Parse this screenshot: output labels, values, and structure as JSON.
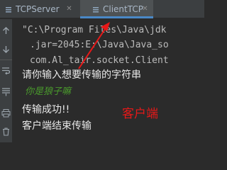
{
  "tabs": [
    {
      "label": "TCPServer",
      "icon": "java-class-icon",
      "close_icon": "close-icon"
    },
    {
      "label": "ClientTCP",
      "icon": "java-class-icon",
      "close_icon": "close-icon",
      "active": true
    }
  ],
  "console": {
    "lines": [
      "\"C:\\Program Files\\Java\\jdk",
      ".jar=2045:E:\\Java\\Java_so",
      "com.Al_tair.socket.Client",
      "请你输入想要传输的字符串",
      "你是狼子嘛",
      "传输成功!!",
      "客户端结束传输"
    ]
  },
  "annotation": {
    "label": "客户端",
    "color": "#e81818"
  },
  "colors": {
    "background": "#2b2b2b",
    "tabbar": "#3c3f41",
    "active_tab_underline": "#4a88c7",
    "input_text": "#4a9a2c"
  }
}
